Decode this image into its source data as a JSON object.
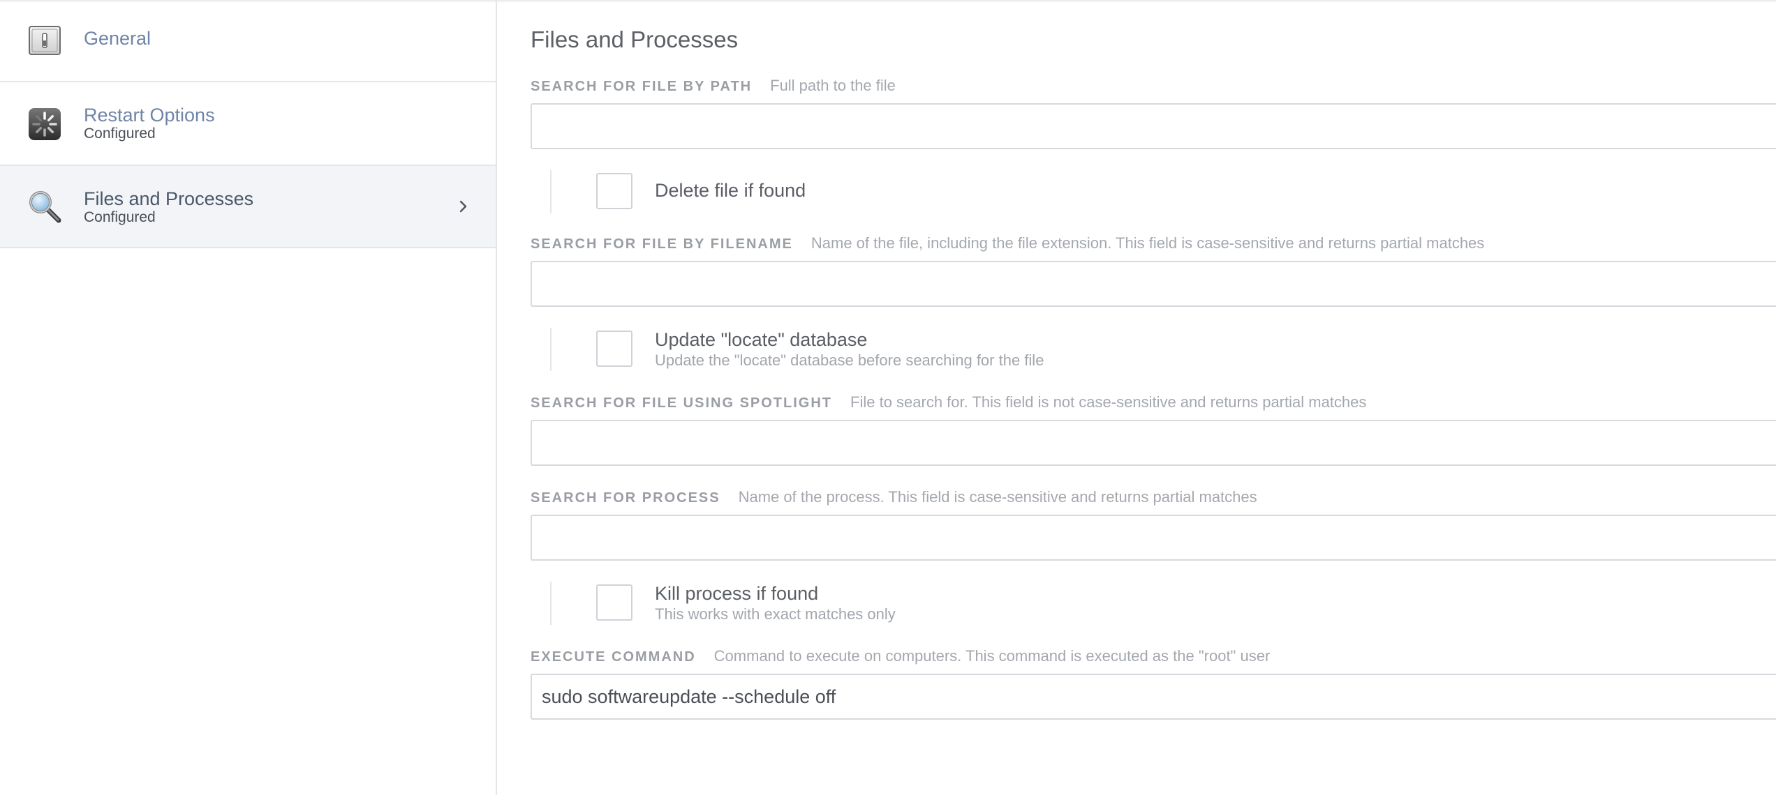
{
  "sidebar": {
    "items": [
      {
        "title": "General",
        "subtitle": "",
        "icon": "general-switch-icon"
      },
      {
        "title": "Restart Options",
        "subtitle": "Configured",
        "icon": "restart-spinner-icon"
      },
      {
        "title": "Files and Processes",
        "subtitle": "Configured",
        "icon": "magnifier-icon",
        "active": true
      }
    ]
  },
  "main": {
    "title": "Files and Processes",
    "path": {
      "label": "SEARCH FOR FILE BY PATH",
      "help": "Full path to the file",
      "value": "",
      "checkbox": {
        "label": "Delete file if found",
        "checked": false
      }
    },
    "filename": {
      "label": "SEARCH FOR FILE BY FILENAME",
      "help": "Name of the file, including the file extension. This field is case-sensitive and returns partial matches",
      "value": "",
      "checkbox": {
        "label": "Update \"locate\" database",
        "sub": "Update the \"locate\" database before searching for the file",
        "checked": false
      }
    },
    "spotlight": {
      "label": "SEARCH FOR FILE USING SPOTLIGHT",
      "help": "File to search for. This field is not case-sensitive and returns partial matches",
      "value": ""
    },
    "process": {
      "label": "SEARCH FOR PROCESS",
      "help": "Name of the process. This field is case-sensitive and returns partial matches",
      "value": "",
      "checkbox": {
        "label": "Kill process if found",
        "sub": "This works with exact matches only",
        "checked": false
      }
    },
    "command": {
      "label": "EXECUTE COMMAND",
      "help": "Command to execute on computers. This command is executed as the \"root\" user",
      "value": "sudo softwareupdate --schedule off"
    }
  },
  "colors": {
    "link": "#6f84a6",
    "active_bg": "#f2f4f8",
    "border": "#d6d9dd",
    "label": "#9a9ea4"
  }
}
